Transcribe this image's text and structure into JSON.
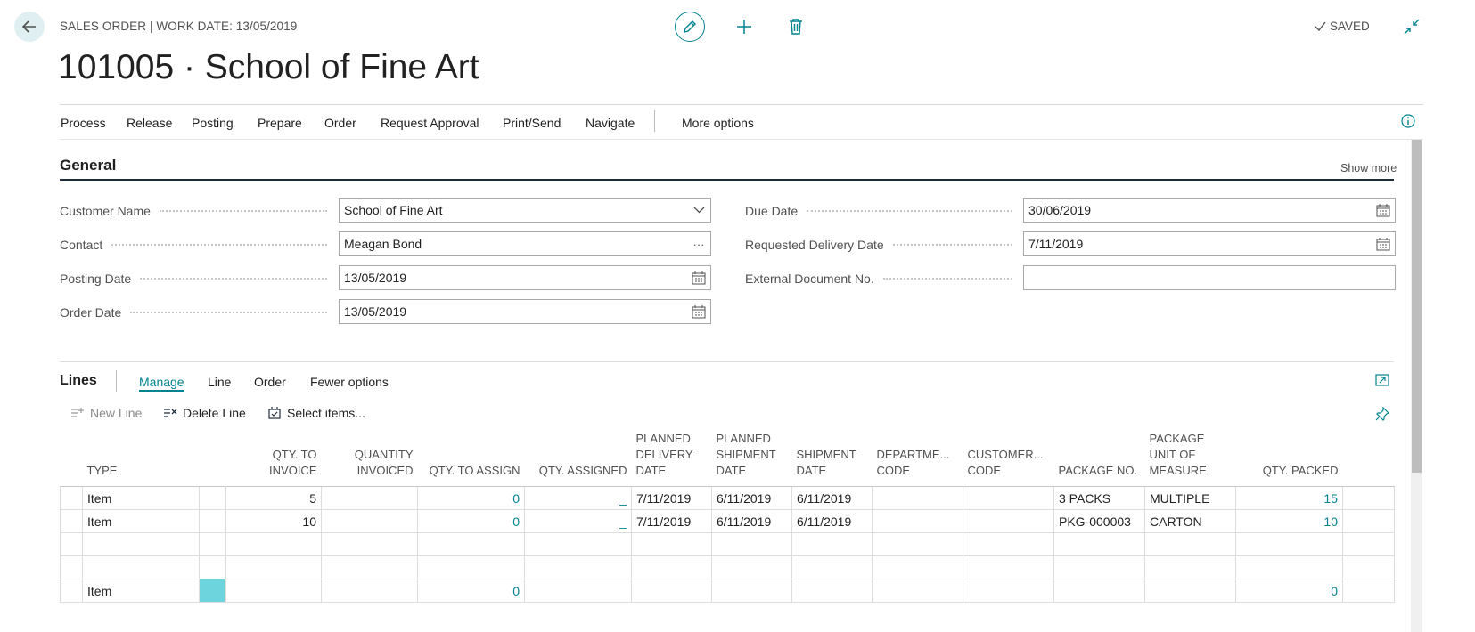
{
  "header": {
    "breadcrumb": "SALES ORDER | WORK DATE: 13/05/2019",
    "title": "101005 · School of Fine Art",
    "saved_label": "SAVED"
  },
  "icons": {
    "back": "arrow-left-icon",
    "edit": "pencil-icon",
    "new": "plus-icon",
    "delete": "trash-icon",
    "saved": "check-icon",
    "collapse": "collapse-icon",
    "info": "info-icon"
  },
  "actions": [
    "Process",
    "Release",
    "Posting",
    "Prepare",
    "Order",
    "Request Approval",
    "Print/Send",
    "Navigate"
  ],
  "more_options": "More options",
  "general": {
    "title": "General",
    "show_more": "Show more",
    "customer_name": {
      "label": "Customer Name",
      "value": "School of Fine Art"
    },
    "contact": {
      "label": "Contact",
      "value": "Meagan Bond"
    },
    "posting_date": {
      "label": "Posting Date",
      "value": "13/05/2019"
    },
    "order_date": {
      "label": "Order Date",
      "value": "13/05/2019"
    },
    "due_date": {
      "label": "Due Date",
      "value": "30/06/2019"
    },
    "requested_delivery_date": {
      "label": "Requested Delivery Date",
      "value": "7/11/2019"
    },
    "external_document_no": {
      "label": "External Document No.",
      "value": ""
    }
  },
  "lines": {
    "title": "Lines",
    "tabs": [
      "Manage",
      "Line",
      "Order",
      "Fewer options"
    ],
    "toolbar": {
      "new_line": "New Line",
      "delete_line": "Delete Line",
      "select_items": "Select items..."
    },
    "columns": {
      "type": "TYPE",
      "qty_to_invoice": "QTY. TO INVOICE",
      "quantity_invoiced": "QUANTITY INVOICED",
      "qty_to_assign": "QTY. TO ASSIGN",
      "qty_assigned": "QTY. ASSIGNED",
      "planned_delivery_date": "PLANNED DELIVERY DATE",
      "planned_shipment_date": "PLANNED SHIPMENT DATE",
      "shipment_date": "SHIPMENT DATE",
      "department_code": "DEPARTME... CODE",
      "customer_code": "CUSTOMER... CODE",
      "package_no": "PACKAGE NO.",
      "package_uom": "PACKAGE UNIT OF MEASURE",
      "qty_packed": "QTY. PACKED"
    },
    "rows": [
      {
        "type": "Item",
        "qty_to_invoice": "5",
        "quantity_invoiced": "",
        "qty_to_assign": "0",
        "qty_assigned": "_",
        "planned_delivery_date": "7/11/2019",
        "planned_shipment_date": "6/11/2019",
        "shipment_date": "6/11/2019",
        "department_code": "",
        "customer_code": "",
        "package_no": "3 PACKS",
        "package_uom": "MULTIPLE",
        "qty_packed": "15"
      },
      {
        "type": "Item",
        "qty_to_invoice": "10",
        "quantity_invoiced": "",
        "qty_to_assign": "0",
        "qty_assigned": "_",
        "planned_delivery_date": "7/11/2019",
        "planned_shipment_date": "6/11/2019",
        "shipment_date": "6/11/2019",
        "department_code": "",
        "customer_code": "",
        "package_no": "PKG-000003",
        "package_uom": "CARTON",
        "qty_packed": "10"
      },
      {
        "type": "",
        "qty_to_invoice": "",
        "quantity_invoiced": "",
        "qty_to_assign": "",
        "qty_assigned": "",
        "planned_delivery_date": "",
        "planned_shipment_date": "",
        "shipment_date": "",
        "department_code": "",
        "customer_code": "",
        "package_no": "",
        "package_uom": "",
        "qty_packed": ""
      },
      {
        "type": "",
        "qty_to_invoice": "",
        "quantity_invoiced": "",
        "qty_to_assign": "",
        "qty_assigned": "",
        "planned_delivery_date": "",
        "planned_shipment_date": "",
        "shipment_date": "",
        "department_code": "",
        "customer_code": "",
        "package_no": "",
        "package_uom": "",
        "qty_packed": ""
      },
      {
        "type": "Item",
        "qty_to_invoice": "",
        "quantity_invoiced": "",
        "qty_to_assign": "0",
        "qty_assigned": "",
        "planned_delivery_date": "",
        "planned_shipment_date": "",
        "shipment_date": "",
        "department_code": "",
        "customer_code": "",
        "package_no": "",
        "package_uom": "",
        "qty_packed": "0"
      }
    ]
  },
  "colors": {
    "accent": "#00838f",
    "selected_cell": "#6dd3dc",
    "section_rule": "#1e2d3d"
  }
}
